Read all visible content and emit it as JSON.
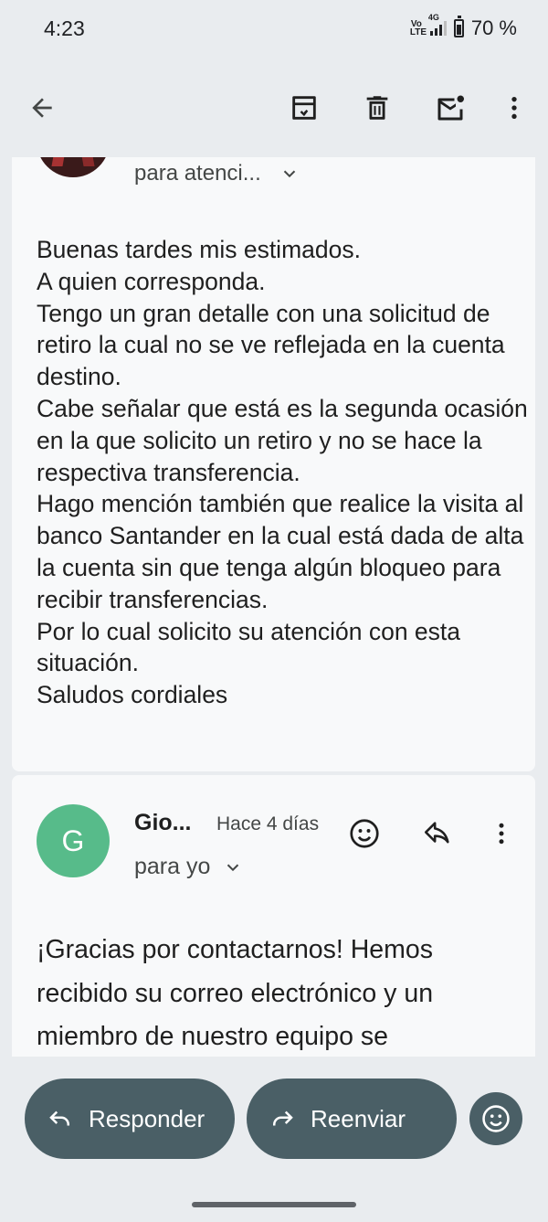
{
  "status_bar": {
    "time": "4:23",
    "volte": "Vo LTE",
    "network": "4G",
    "battery": "70 %"
  },
  "toolbar": {
    "icons": [
      "back-arrow-icon",
      "archive-icon",
      "delete-icon",
      "mark-unread-icon",
      "more-options-icon"
    ]
  },
  "message1": {
    "recipient": "para atenci...",
    "body": "Buenas tardes mis estimados.\nA quien corresponda.\nTengo un gran detalle  con una solicitud de retiro la cual no se ve reflejada en la cuenta destino.\nCabe señalar que está es la segunda ocasión en la que solicito un retiro y no se hace la respectiva transferencia.\nHago mención también que realice la visita al banco Santander en la cual está dada de alta la cuenta sin que tenga algún bloqueo para recibir transferencias.\nPor lo cual solicito su atención con esta situación.\nSaludos cordiales"
  },
  "message2": {
    "avatar_letter": "G",
    "avatar_color": "#57bb8a",
    "sender": "Gio...",
    "time": "Hace 4 días",
    "recipient": "para yo",
    "body": "¡Gracias por contactarnos! Hemos recibido su correo electrónico y un miembro de nuestro equipo se"
  },
  "bottom_bar": {
    "reply_label": "Responder",
    "forward_label": "Reenviar"
  },
  "colors": {
    "background": "#e9ecef",
    "card": "#f8f9fa",
    "pill": "#4a5f66"
  }
}
